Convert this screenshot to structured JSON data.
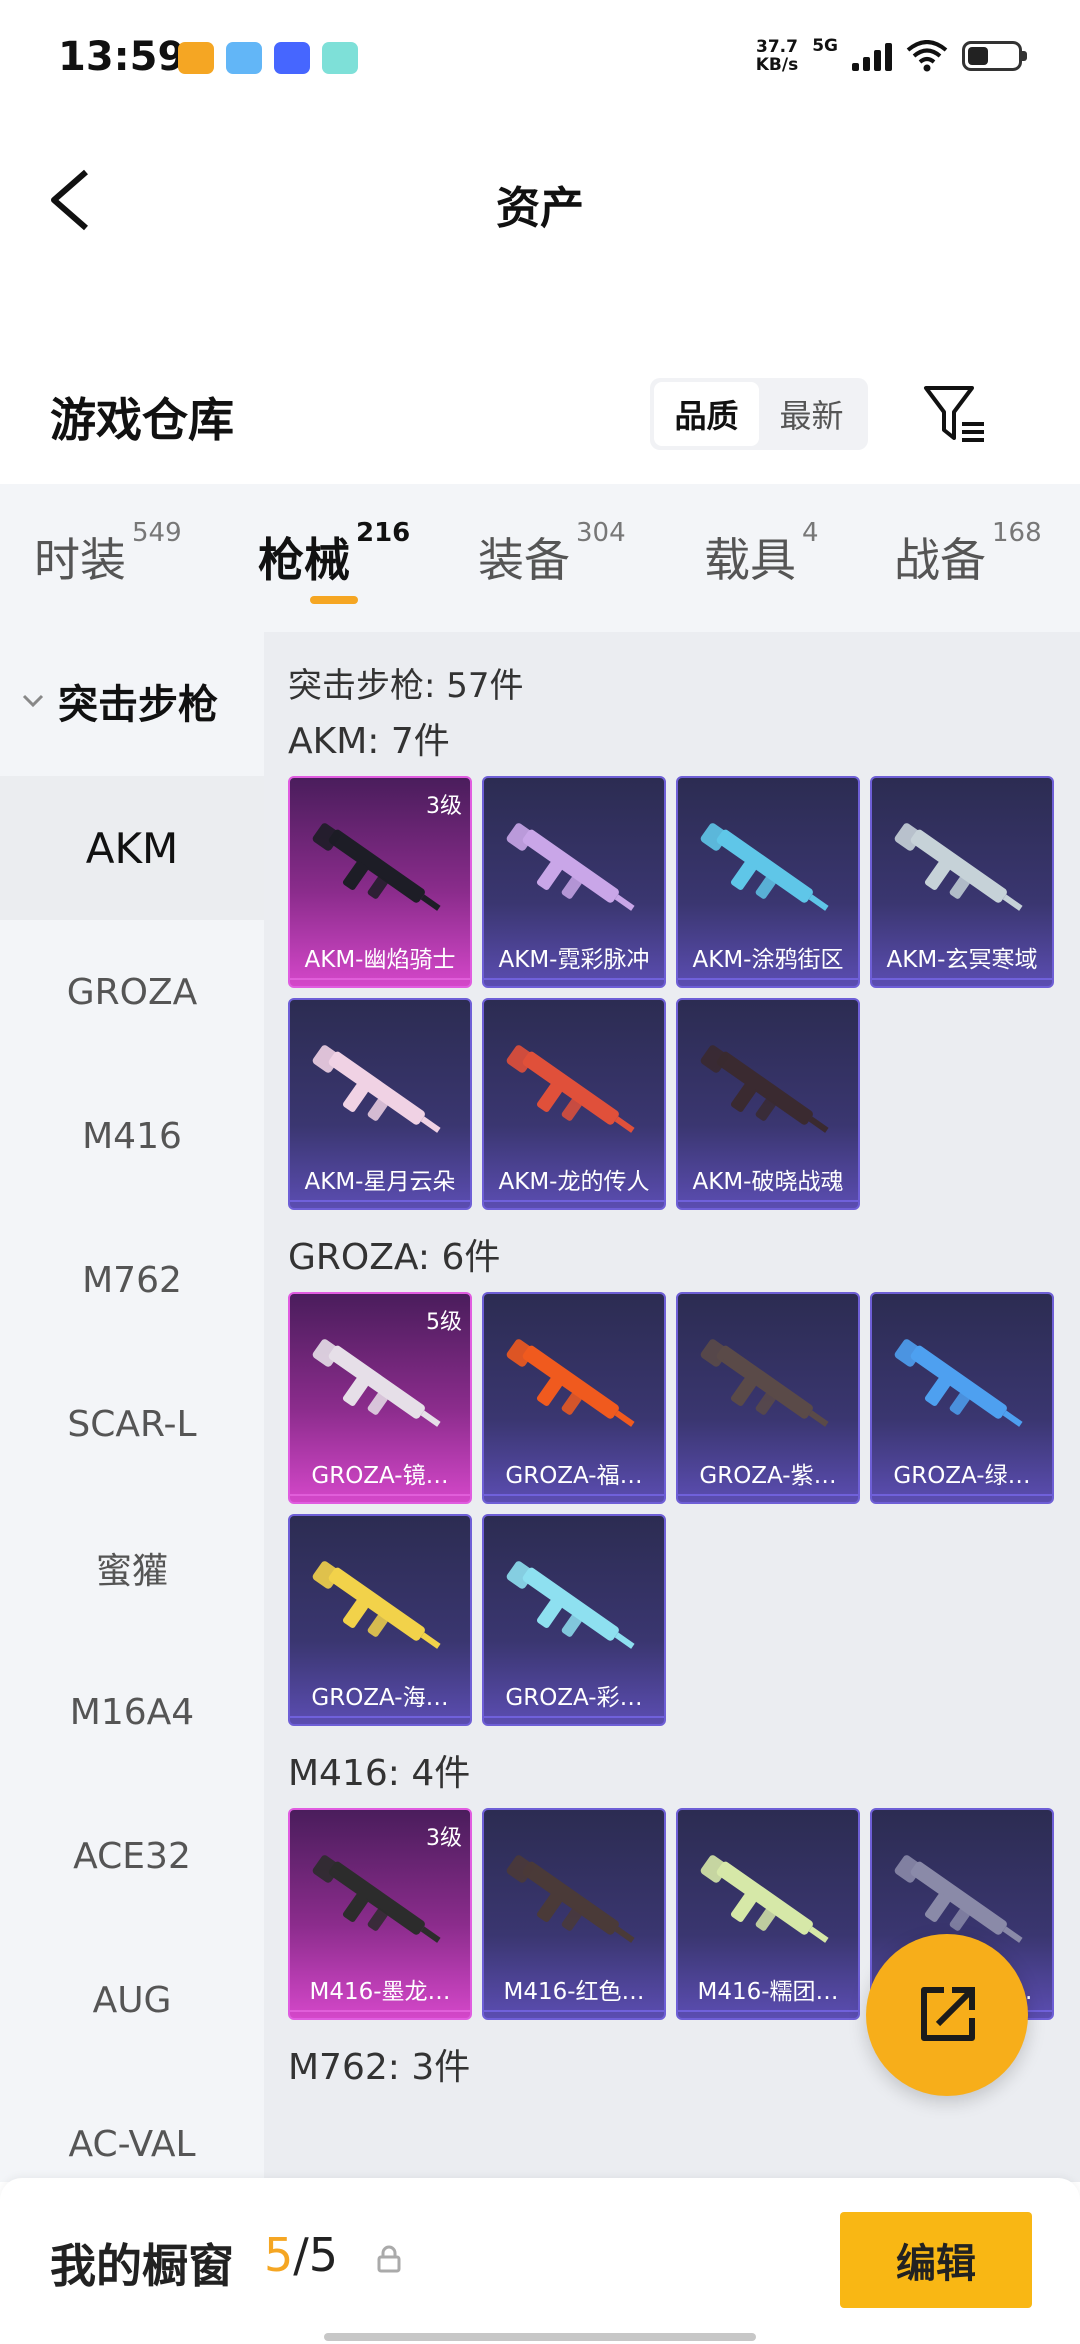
{
  "status_bar": {
    "time": "13:59",
    "speed_value": "37.7",
    "speed_unit": "KB/s",
    "network": "5G",
    "app_colors": [
      "#f5a623",
      "#62b6f7",
      "#4666ff",
      "#7ee0d8"
    ]
  },
  "header": {
    "title": "资产",
    "back_icon": "chevron-left-icon"
  },
  "warehouse": {
    "title": "游戏仓库",
    "sort_options": [
      "品质",
      "最新"
    ],
    "selected_sort": "品质",
    "filter_icon": "filter-icon"
  },
  "tabs": [
    {
      "label": "时装",
      "count": "549"
    },
    {
      "label": "枪械",
      "count": "216",
      "active": true
    },
    {
      "label": "装备",
      "count": "304"
    },
    {
      "label": "载具",
      "count": "4"
    },
    {
      "label": "战备",
      "count": "168"
    }
  ],
  "sidenav": {
    "group_label": "突击步枪",
    "items": [
      "AKM",
      "GROZA",
      "M416",
      "M762",
      "SCAR-L",
      "蜜獾",
      "M16A4",
      "ACE32",
      "AUG",
      "AC-VAL"
    ],
    "active": "AKM"
  },
  "content": {
    "total_label": "突击步枪: 57件",
    "groups": [
      {
        "title": "AKM: 7件",
        "items": [
          {
            "name": "AKM-幽焰骑士",
            "level": "3级",
            "rarity": "purple"
          },
          {
            "name": "AKM-霓彩脉冲",
            "level": "",
            "rarity": "blue"
          },
          {
            "name": "AKM-涂鸦街区",
            "level": "",
            "rarity": "blue"
          },
          {
            "name": "AKM-玄冥寒域",
            "level": "",
            "rarity": "blue"
          },
          {
            "name": "AKM-星月云朵",
            "level": "",
            "rarity": "blue"
          },
          {
            "name": "AKM-龙的传人",
            "level": "",
            "rarity": "blue"
          },
          {
            "name": "AKM-破晓战魂",
            "level": "",
            "rarity": "blue"
          }
        ]
      },
      {
        "title": "GROZA: 6件",
        "items": [
          {
            "name": "GROZA-镜…",
            "level": "5级",
            "rarity": "purple"
          },
          {
            "name": "GROZA-福…",
            "level": "",
            "rarity": "blue"
          },
          {
            "name": "GROZA-紫…",
            "level": "",
            "rarity": "blue"
          },
          {
            "name": "GROZA-绿…",
            "level": "",
            "rarity": "blue"
          },
          {
            "name": "GROZA-海…",
            "level": "",
            "rarity": "blue"
          },
          {
            "name": "GROZA-彩…",
            "level": "",
            "rarity": "blue"
          }
        ]
      },
      {
        "title": "M416: 4件",
        "items": [
          {
            "name": "M416-墨龙…",
            "level": "3级",
            "rarity": "purple"
          },
          {
            "name": "M416-红色…",
            "level": "",
            "rarity": "blue"
          },
          {
            "name": "M416-糯团…",
            "level": "",
            "rarity": "blue"
          },
          {
            "name": "M416-…色…",
            "level": "",
            "rarity": "blue"
          }
        ]
      },
      {
        "title": "M762: 3件",
        "items": []
      }
    ]
  },
  "fab": {
    "icon": "share-external-icon"
  },
  "showcase": {
    "label": "我的橱窗",
    "used": "5",
    "separator": "/",
    "total": "5",
    "lock_icon": "lock-icon",
    "edit_label": "编辑"
  },
  "colors": {
    "accent": "#f5a623",
    "edit_button": "#f9b714",
    "rare_purple": "#d447c9",
    "rare_blue": "#5b4db1"
  }
}
